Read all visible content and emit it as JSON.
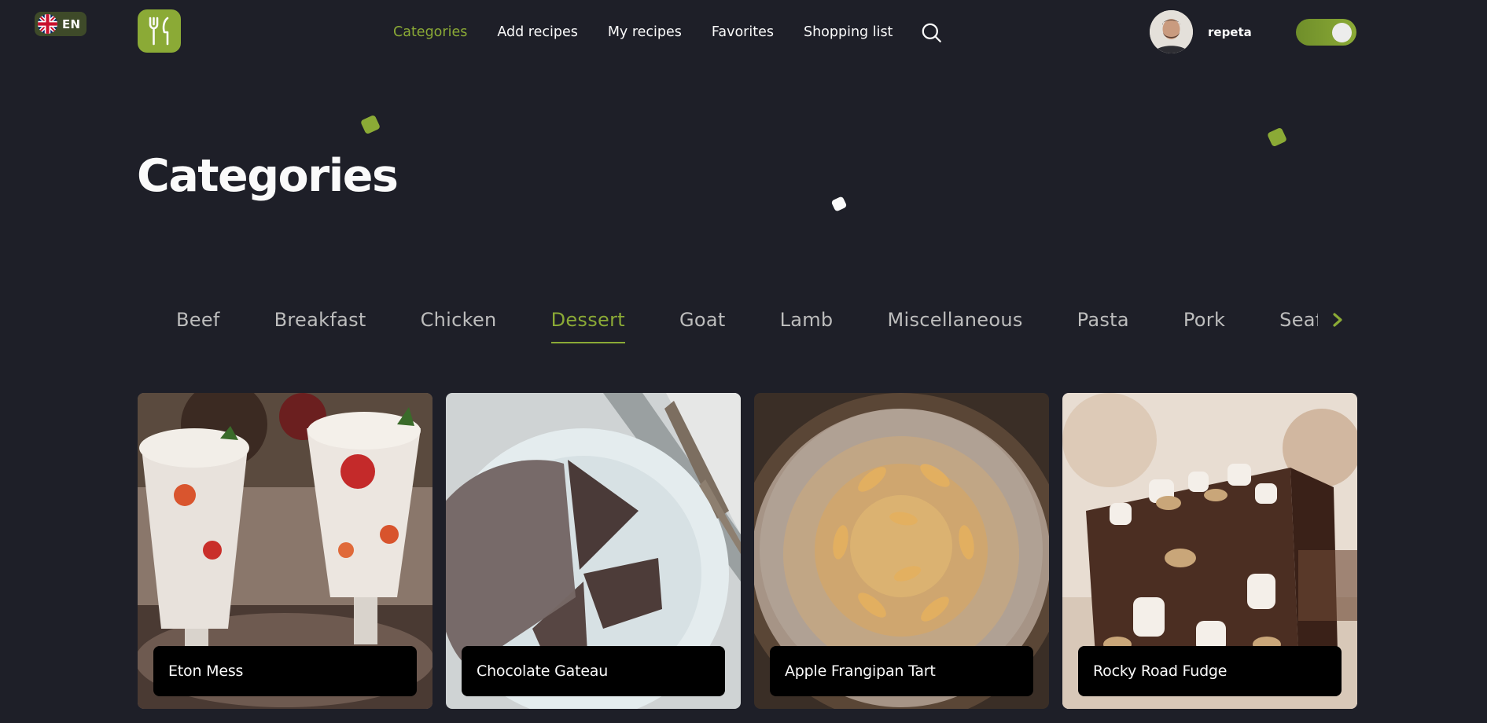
{
  "header": {
    "language": "EN",
    "nav": [
      {
        "label": "Categories",
        "active": true
      },
      {
        "label": "Add recipes",
        "active": false
      },
      {
        "label": "My recipes",
        "active": false
      },
      {
        "label": "Favorites",
        "active": false
      },
      {
        "label": "Shopping list",
        "active": false
      }
    ],
    "user_name": "repeta",
    "theme_toggle_on": true
  },
  "page": {
    "title": "Categories"
  },
  "categories": {
    "tabs": [
      "Beef",
      "Breakfast",
      "Chicken",
      "Dessert",
      "Goat",
      "Lamb",
      "Miscellaneous",
      "Pasta",
      "Pork",
      "Seafood"
    ],
    "active": "Dessert"
  },
  "recipes": [
    {
      "title": "Eton Mess"
    },
    {
      "title": "Chocolate Gateau"
    },
    {
      "title": "Apple Frangipan Tart"
    },
    {
      "title": "Rocky Road Fudge"
    }
  ],
  "colors": {
    "background": "#1e1f28",
    "accent": "#8baa36",
    "text": "#fafafa",
    "muted": "#bdbdbd"
  },
  "icons": {
    "language_flag": "uk-flag-icon",
    "logo": "fork-knife-icon",
    "search": "search-icon",
    "tabs_next": "chevron-right-icon"
  }
}
